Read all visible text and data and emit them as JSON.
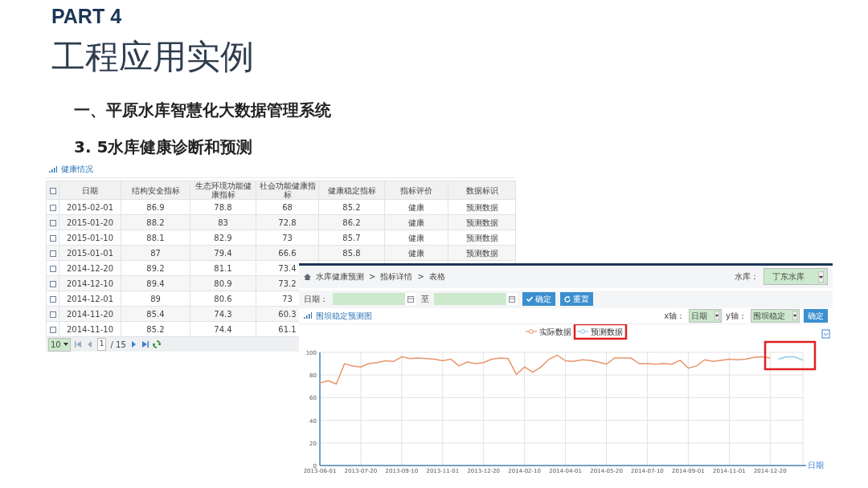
{
  "slide": {
    "part": "PART 4",
    "title": "工程应用实例",
    "heading": "一、平原水库智慧化大数据管理系统",
    "subheading": "3. 5水库健康诊断和预测"
  },
  "health_window": {
    "title": "健康情况",
    "header_checked": false,
    "columns": [
      "日期",
      "结构安全指标",
      "生态环境功能健康指标",
      "社会功能健康指标",
      "健康稳定指标",
      "指标评价",
      "数据标识"
    ],
    "rows": [
      {
        "checked": false,
        "cells": [
          "2015-02-01",
          "86.9",
          "78.8",
          "68",
          "85.2",
          "健康",
          "预测数据"
        ]
      },
      {
        "checked": false,
        "cells": [
          "2015-01-20",
          "88.2",
          "83",
          "72.8",
          "86.2",
          "健康",
          "预测数据"
        ]
      },
      {
        "checked": false,
        "cells": [
          "2015-01-10",
          "88.1",
          "82.9",
          "73",
          "85.7",
          "健康",
          "预测数据"
        ]
      },
      {
        "checked": false,
        "cells": [
          "2015-01-01",
          "87",
          "79.4",
          "66.6",
          "85.8",
          "健康",
          "预测数据"
        ]
      },
      {
        "checked": false,
        "cells": [
          "2014-12-20",
          "89.2",
          "81.1",
          "73.4"
        ]
      },
      {
        "checked": false,
        "cells": [
          "2014-12-10",
          "89.4",
          "80.9",
          "73.2"
        ]
      },
      {
        "checked": false,
        "cells": [
          "2014-12-01",
          "89",
          "80.6",
          "73"
        ]
      },
      {
        "checked": false,
        "cells": [
          "2014-11-20",
          "85.4",
          "74.3",
          "60.3"
        ]
      },
      {
        "checked": false,
        "cells": [
          "2014-11-10",
          "85.2",
          "74.4",
          "61.1"
        ]
      }
    ],
    "pager": {
      "page_size": "10",
      "page": "1",
      "page_count": "/ 15"
    }
  },
  "chart_window": {
    "breadcrumb": [
      "水库健康预测",
      ">",
      "指标详情",
      ">",
      "表格"
    ],
    "reservoir_label": "水库：",
    "reservoir": "丁东水库",
    "date_label": "日期：",
    "date_to": "至",
    "confirm_button": "确定",
    "reset_button": "重置",
    "chart_title": "围坝稳定预测图",
    "x_axis_label": "x轴：",
    "x_axis": "日期",
    "y_axis_label": "y轴：",
    "y_axis": "围坝稳定",
    "axis_confirm_button": "确定",
    "highlight_legend_item": true,
    "highlight_forecast": true,
    "chart_data": {
      "type": "line",
      "xlabel": "日期",
      "grid": true,
      "legend": "top",
      "ylim": [
        0,
        100
      ],
      "yticks": [
        0,
        20,
        40,
        60,
        80,
        100
      ],
      "categories": [
        "2013-06-01",
        null,
        null,
        null,
        null,
        "2013-07-20",
        null,
        null,
        null,
        null,
        "2013-09-10",
        null,
        null,
        null,
        null,
        "2013-11-01",
        null,
        null,
        null,
        null,
        "2013-12-20",
        null,
        null,
        null,
        null,
        "2014-02-10",
        null,
        null,
        null,
        null,
        "2014-04-01",
        null,
        null,
        null,
        null,
        "2014-05-20",
        null,
        null,
        null,
        null,
        "2014-07-10",
        null,
        null,
        null,
        null,
        "2014-09-01",
        null,
        null,
        null,
        null,
        "2014-11-01",
        null,
        null,
        null,
        null,
        "2014-12-20",
        null,
        null,
        null,
        null
      ],
      "series": [
        {
          "name": "实际数据",
          "color": "#e8956a",
          "values": [
            73,
            75,
            72,
            90,
            88,
            87,
            90,
            91,
            92.5,
            92,
            96,
            94.5,
            95,
            94.5,
            94,
            92.5,
            94,
            88,
            91.5,
            90,
            91,
            94,
            95,
            94.5,
            80.5,
            87,
            82.5,
            87,
            94,
            97.5,
            92.5,
            92,
            93.5,
            93,
            91.5,
            89.5,
            95,
            95,
            95,
            90,
            90,
            89.5,
            90,
            89.5,
            93,
            86,
            88,
            93.5,
            92,
            93,
            94,
            93.5,
            94,
            95.5,
            96,
            95,
            null,
            null,
            null,
            null
          ]
        },
        {
          "name": "预测数据",
          "color": "#8ccbe8",
          "values": [
            null,
            null,
            null,
            null,
            null,
            null,
            null,
            null,
            null,
            null,
            null,
            null,
            null,
            null,
            null,
            null,
            null,
            null,
            null,
            null,
            null,
            null,
            null,
            null,
            null,
            null,
            null,
            null,
            null,
            null,
            null,
            null,
            null,
            null,
            null,
            null,
            null,
            null,
            null,
            null,
            null,
            null,
            null,
            null,
            null,
            null,
            null,
            null,
            null,
            null,
            null,
            null,
            null,
            null,
            null,
            null,
            94,
            96,
            96,
            93
          ]
        }
      ]
    }
  }
}
